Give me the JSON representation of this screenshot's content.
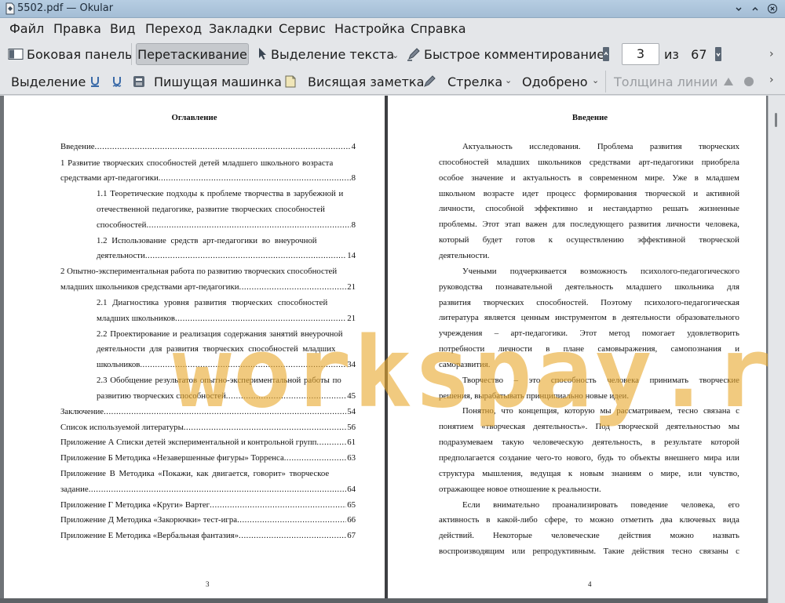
{
  "window": {
    "title": "5502.pdf  — Okular"
  },
  "menu": [
    "Файл",
    "Правка",
    "Вид",
    "Переход",
    "Закладки",
    "Сервис",
    "Настройка",
    "Справка"
  ],
  "toolbar1": {
    "sidebar": "Боковая панель",
    "drag": "Перетаскивание",
    "text_select": "Выделение текста",
    "quick_annot": "Быстрое комментирование",
    "current_page": "3",
    "of_label": "из",
    "total_pages": "67"
  },
  "toolbar2": {
    "highlight": "Выделение",
    "typewriter": "Пишущая машинка",
    "popup_note": "Висящая заметка",
    "arrow": "Стрелка",
    "stamp": "Одобрено",
    "line_width": "Толщина линии"
  },
  "watermark": "workspay.ru",
  "left_page": {
    "heading": "Оглавление",
    "page_number": "3",
    "toc": [
      {
        "text": "Введение",
        "page": "4"
      },
      {
        "line1": "1 Развитие творческих способностей детей младшего школьного возраста",
        "text": "средствами арт-педагогики",
        "page": "8"
      },
      {
        "line1": "1.1 Теоретические подходы к проблеме творчества в зарубежной и",
        "line2": "отечественной педагогике, развитие творческих способностей личности",
        "text": "способностей",
        "page": "8"
      },
      {
        "line1": "1.2  Использование  средств  арт-педагогики  во  внеурочной",
        "text": "деятельности",
        "page": "14"
      },
      {
        "line1": "2 Опытно-экспериментальная работа по развитию творческих способностей",
        "text": "младших школьников средствами арт-педагогики",
        "page": "21"
      },
      {
        "line1": "2.1  Диагностика  уровня  развития  творческих  способностей",
        "text": "младших школьников",
        "page": "21"
      },
      {
        "line1": "2.2 Проектирование и реализация содержания занятий внеурочной",
        "line2": "деятельности  для  развития  творческих  способностей  младших",
        "text": "школьников",
        "page": "34"
      },
      {
        "line1": "2.3 Обобщение результатов опытно-экспериментальной работы по",
        "text": "развитию творческих способностей",
        "page": "45"
      },
      {
        "text": "Заключение",
        "page": "54"
      },
      {
        "text": "Список используемой литературы",
        "page": "56"
      },
      {
        "text": "Приложение А Списки детей экспериментальной и контрольной групп",
        "page": "61"
      },
      {
        "text": "Приложение Б Методика «Незавершенные фигуры» Торренса",
        "page": "63"
      },
      {
        "line1": "Приложение  В  Методика  «Покажи,  как  двигается,  говорит»  творческое",
        "text": "задание",
        "page": "64"
      },
      {
        "text": "Приложение Г Методика «Круги» Вартег",
        "page": "65"
      },
      {
        "text": "Приложение Д Методика «Закорючки» тест-игра",
        "page": "66"
      },
      {
        "text": "Приложение Е Методика «Вербальная фантазия»",
        "page": "67"
      }
    ]
  },
  "right_page": {
    "heading": "Введение",
    "page_number": "4",
    "lines": [
      "Актуальность   исследования.   Проблема   развития   творческих",
      "способностей младших школьников средствами арт-педагогики приобрела",
      "особое  значение  и  актуальность  в  современном  мире.  Уже  в  младшем",
      "школьном  возрасте  идет  процесс  формирования  творческой  и  активной",
      "личности,   способной   эффективно   и   нестандартно   решать   жизненные",
      "проблемы. Этот этап важен для последующего развития личности человека,",
      "который   будет   готов   к   осуществлению   эффективной   творческой",
      "деятельности.",
      "Учеными  подчеркивается  возможность  психолого-педагогического",
      "руководства  познавательной  деятельность  младшего  школьника  для",
      "развития  творческих  способностей.  Поэтому  психолого-педагогическая",
      "литература является ценным инструментом в деятельности образовательного",
      "учреждения   –   арт-педагогики.   Этот   метод   помогает   удовлетворить",
      "потребности     личности     в     плане     самовыражения,     самопознания     и",
      "саморазвития.",
      "Творчество  –  это  способность  человека  принимать  творческие",
      "решения, вырабатывать принципиально новые идеи.",
      "Понятно, что концепция, которую мы рассматриваем, тесно связана с",
      "понятием  «творческая  деятельность».  Под  творческой  деятельностью  мы",
      "подразумеваем  такую  человеческую  деятельность,  в  результате  которой",
      "предполагается создание чего-то нового, будь то объекты внешнего мира или",
      "структура  мышления,  ведущая  к  новым  знаниям  о  мире,  или  чувство,",
      "отражающее новое отношение к реальности.",
      "Если   внимательно   проанализировать   поведение   человека,   его",
      "активность  в  какой-либо  сфере,  то  можно  отметить  два  ключевых  вида",
      "действий.     Некоторые     человеческие     действия     можно     назвать",
      "воспроизводящим  или  репродуктивным.  Такие  действия  тесно  связаны  с"
    ]
  }
}
